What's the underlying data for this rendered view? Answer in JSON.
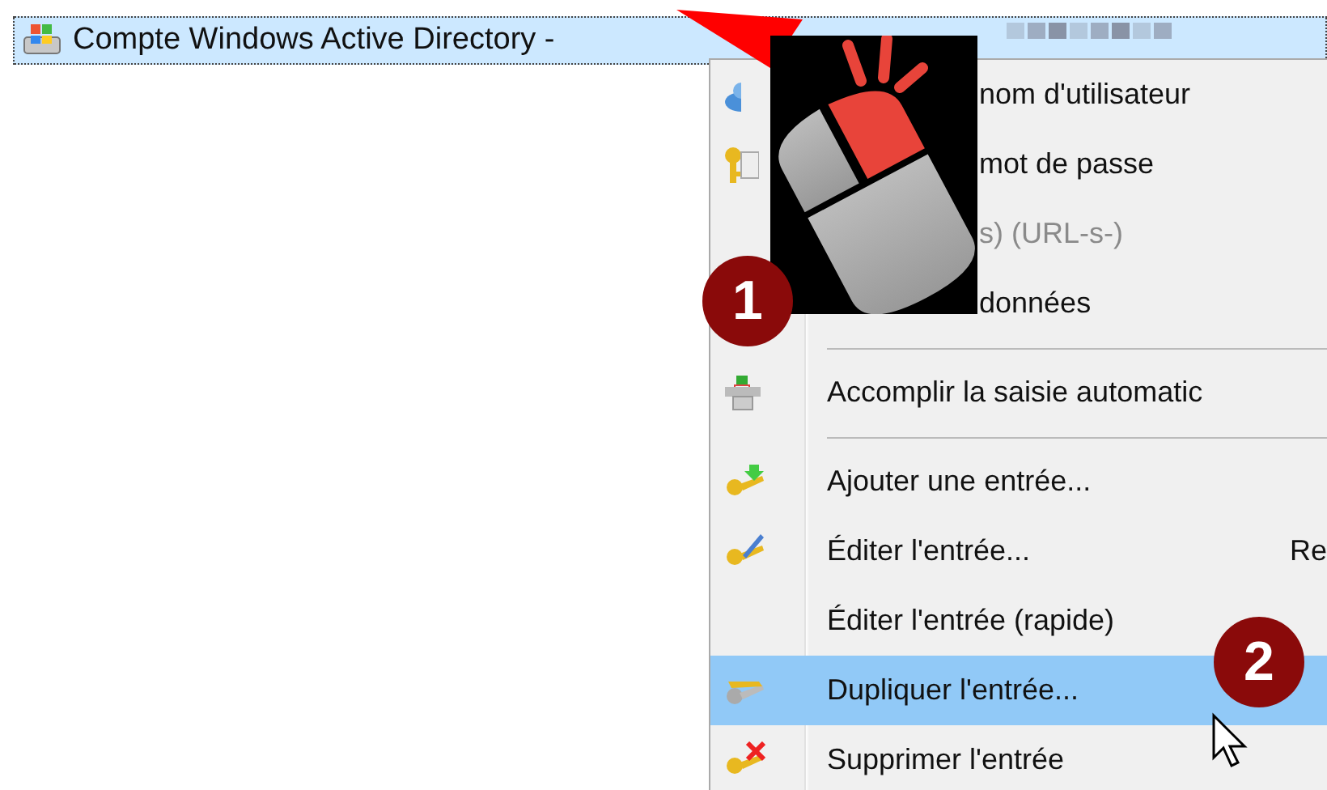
{
  "entry": {
    "title": "Compte Windows Active Directory -",
    "selected": true
  },
  "context_menu": {
    "items": [
      {
        "kind": "covered-item",
        "label": "nom d'utilisateur",
        "disabled": false,
        "selected": false
      },
      {
        "kind": "covered-item",
        "label": "mot de passe",
        "disabled": false,
        "selected": false
      },
      {
        "kind": "covered-item",
        "label": "s) (URL-s-)",
        "disabled": true,
        "selected": false
      },
      {
        "kind": "covered-item",
        "label": "données",
        "disabled": false,
        "selected": false
      },
      {
        "kind": "separator"
      },
      {
        "kind": "item",
        "label": "Accomplir la saisie automatic",
        "disabled": false,
        "selected": false
      },
      {
        "kind": "separator"
      },
      {
        "kind": "item",
        "label": "Ajouter une entrée...",
        "disabled": false,
        "selected": false
      },
      {
        "kind": "item",
        "label": "Éditer l'entrée...",
        "shortcut": "Re",
        "disabled": false,
        "selected": false
      },
      {
        "kind": "item",
        "label": "Éditer l'entrée (rapide)",
        "disabled": false,
        "selected": false
      },
      {
        "kind": "item",
        "label": "Dupliquer l'entrée...",
        "disabled": false,
        "selected": true
      },
      {
        "kind": "item",
        "label": "Supprimer l'entrée",
        "disabled": false,
        "selected": false
      }
    ]
  },
  "badges": [
    {
      "label": "1"
    },
    {
      "label": "2"
    }
  ]
}
